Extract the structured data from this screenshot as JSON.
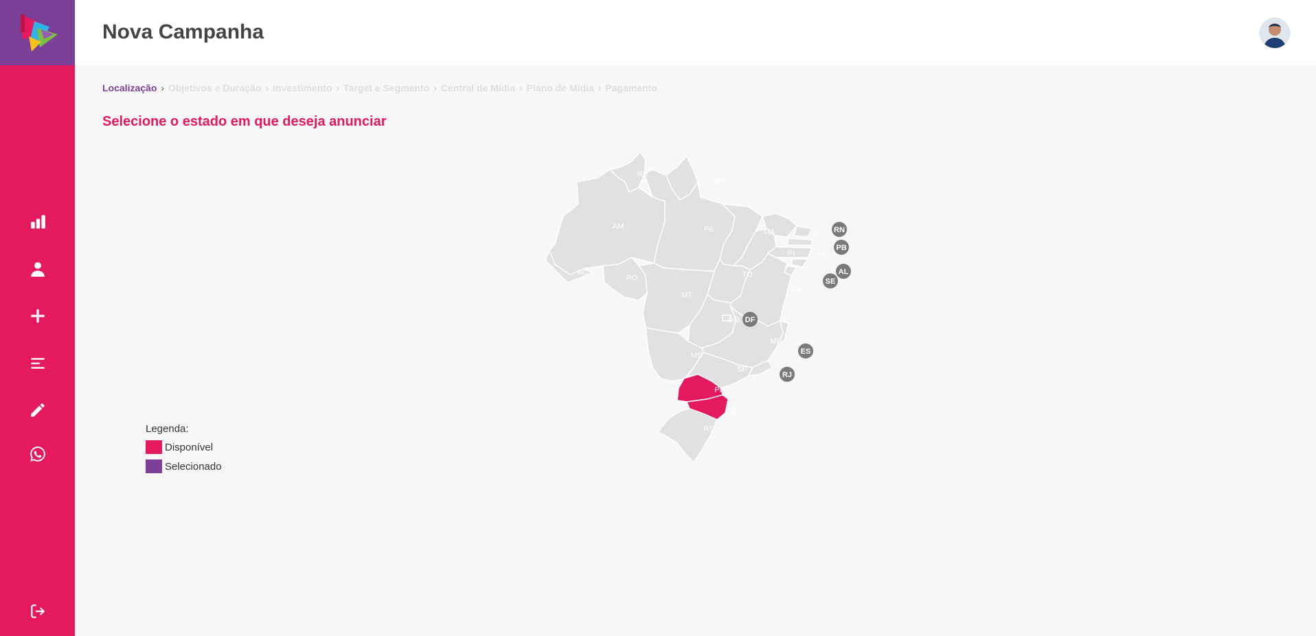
{
  "header": {
    "title": "Nova Campanha"
  },
  "sidebar": {
    "logo": "logo-icon",
    "items": [
      {
        "icon": "bar-chart-icon"
      },
      {
        "icon": "user-icon"
      },
      {
        "icon": "plus-icon"
      },
      {
        "icon": "list-icon"
      },
      {
        "icon": "pencil-icon"
      },
      {
        "icon": "whatsapp-icon"
      }
    ],
    "logout_icon": "logout-icon"
  },
  "breadcrumb": {
    "steps": [
      "Localização",
      "Objetivos e Duração",
      "Investimento",
      "Target e Segmento",
      "Central de Mídia",
      "Plano de Mídia",
      "Pagamento"
    ],
    "active_index": 0
  },
  "main": {
    "subtitle": "Selecione o estado em que deseja anunciar"
  },
  "map": {
    "states": {
      "RR": "RR",
      "AP": "AP",
      "AM": "AM",
      "PA": "PA",
      "MA": "MA",
      "CE": "CE",
      "PI": "PI",
      "PE": "PE",
      "AC": "AC",
      "RO": "RO",
      "TO": "TO",
      "MT": "MT",
      "BA": "BA",
      "GO": "GO",
      "MG": "MG",
      "MS": "MS",
      "SP": "SP",
      "PR": "PR",
      "SC": "SC",
      "RS": "RS"
    },
    "small_states": {
      "RN": "RN",
      "PB": "PB",
      "AL": "AL",
      "SE": "SE",
      "DF": "DF",
      "ES": "ES",
      "RJ": "RJ"
    },
    "available": [
      "PR",
      "SC"
    ]
  },
  "legend": {
    "title": "Legenda:",
    "items": [
      {
        "label": "Disponível",
        "color": "#e5195d"
      },
      {
        "label": "Selecionado",
        "color": "#7b3f97"
      }
    ]
  },
  "colors": {
    "primary": "#e5195d",
    "secondary": "#7b3f97",
    "map_state": "#e1e1e1",
    "pin": "#7a7a7a"
  }
}
